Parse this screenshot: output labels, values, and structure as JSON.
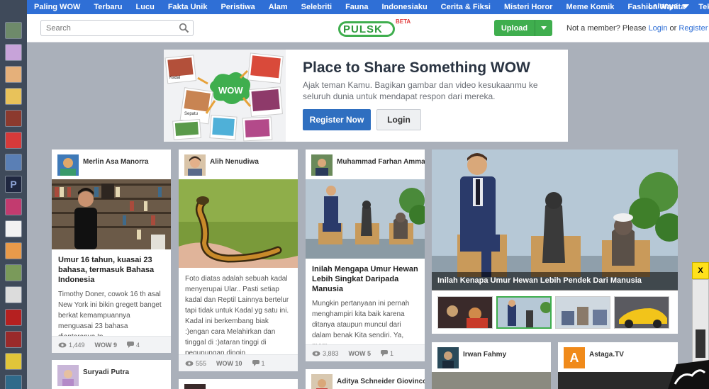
{
  "nav": {
    "items": [
      "Paling WOW",
      "Terbaru",
      "Lucu",
      "Fakta Unik",
      "Peristiwa",
      "Alam",
      "Selebriti",
      "Fauna",
      "Indonesiaku",
      "Cerita & Fiksi",
      "Misteri Horor",
      "Meme Komik",
      "Fashion Wanita",
      "Teknologi"
    ],
    "more": "Lainnya"
  },
  "header": {
    "search_placeholder": "Search",
    "logo_text": "PULSK",
    "logo_badge": "BETA",
    "upload_label": "Upload",
    "member_text": "Not a member? Please",
    "login_link": "Login",
    "or_text": "or",
    "register_link": "Register"
  },
  "hero": {
    "title": "Place to Share Something WOW",
    "subtitle": "Ajak teman Kamu. Bagikan gambar dan video kesukaanmu ke seluruh dunia untuk mendapat respon dari mereka.",
    "register_label": "Register Now",
    "login_label": "Login",
    "art_bubble": "WOW",
    "art_label1": "Kadal",
    "art_label2": "Sepatu"
  },
  "cards": [
    {
      "user": "Merlin Asa Manorra",
      "title": "Umur 16 tahun, kuasai 23 bahasa, termasuk Bahasa Indonesia",
      "desc": "Timothy Doner, cowok 16 th asal New York ini bikin gregett banget berkat kemampuannya menguasai 23 bahasa diantaranya In...",
      "views": "1,449",
      "wow": "WOW 9",
      "comments": "4"
    },
    {
      "user": "Alih Nenudiwa",
      "title": "",
      "desc": "Foto diatas adalah sebuah kadal menyerupai Ular.. Pasti setiap kadal dan Reptil Lainnya bertelur tapi tidak untuk Kadal yg satu ini. Kadal ini berkembang biak :)engan cara Melahirkan dan tinggal di :)ataran tinggi di pegunungan dingin",
      "views": "555",
      "wow": "WOW 10",
      "comments": "1"
    },
    {
      "user": "Muhammad Farhan Amma",
      "title": "Inilah Mengapa Umur Hewan Lebih Singkat Daripada Manusia",
      "desc": "Mungkin pertanyaan ini pernah menghampiri kita baik karena ditanya ataupun muncul dari dalam benak Kita sendiri. Ya, mem...",
      "views": "3,883",
      "wow": "WOW 5",
      "comments": "1"
    }
  ],
  "lower_cards": [
    {
      "user": "Suryadi Putra"
    },
    {
      "user": "Aditya Schneider Giovinco"
    },
    {
      "user": "Irwan Fahmy"
    },
    {
      "user": "Astaga.TV",
      "avatar_letter": "A"
    }
  ],
  "featured": {
    "caption": "Inilah Kenapa Umur Hewan Lebih Pendek Dari Manusia"
  },
  "side": {
    "close_label": "X"
  },
  "colors": {
    "nav_blue": "#2f6fd6",
    "upload_green": "#3fae4e",
    "register_blue": "#2f6fc0",
    "page_bg": "#aab0ba"
  }
}
